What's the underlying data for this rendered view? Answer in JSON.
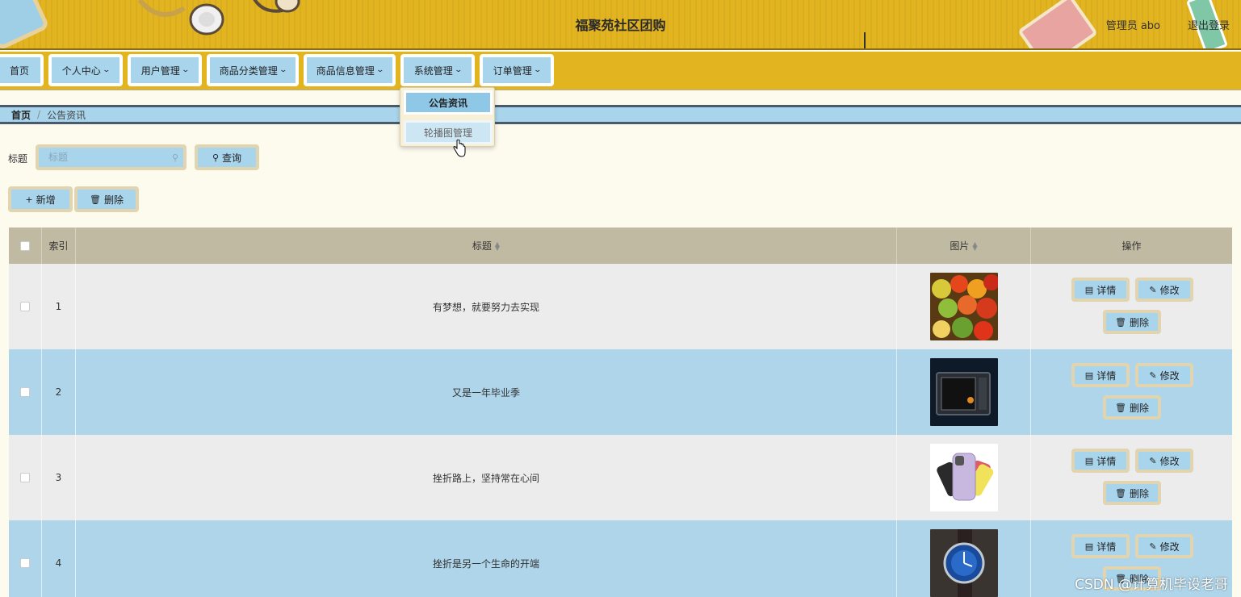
{
  "header": {
    "title": "福聚苑社区团购",
    "user_info": "管理员 abo",
    "logout": "退出登录"
  },
  "nav": {
    "items": [
      {
        "label": "首页"
      },
      {
        "label": "个人中心"
      },
      {
        "label": "用户管理"
      },
      {
        "label": "商品分类管理"
      },
      {
        "label": "商品信息管理"
      },
      {
        "label": "系统管理"
      },
      {
        "label": "订单管理"
      }
    ],
    "dropdown": [
      "公告资讯",
      "轮播图管理"
    ]
  },
  "breadcrumb": {
    "home": "首页",
    "separator": "/",
    "current": "公告资讯"
  },
  "search": {
    "label": "标题",
    "placeholder": "标题",
    "query_button": "查询"
  },
  "actions": {
    "add_button": "新增",
    "delete_button": "删除"
  },
  "table": {
    "columns": {
      "index": "索引",
      "title": "标题",
      "image": "图片",
      "ops": "操作"
    },
    "row_buttons": {
      "detail": "详情",
      "edit": "修改",
      "delete": "删除"
    },
    "rows": [
      {
        "index": "1",
        "title": "有梦想，就要努力去实现",
        "image": "fruit-photo"
      },
      {
        "index": "2",
        "title": "又是一年毕业季",
        "image": "microwave-photo"
      },
      {
        "index": "3",
        "title": "挫折路上，坚持常在心间",
        "image": "phone-photo"
      },
      {
        "index": "4",
        "title": "挫折是另一个生命的开端",
        "image": "watch-photo"
      }
    ]
  },
  "watermark": "CSDN @计算机毕设老哥",
  "colors": {
    "header_bg": "#e2b420",
    "accent_blue": "#a8d4ec",
    "table_header": "#c0baa2",
    "page_bg": "#fdfaee"
  }
}
